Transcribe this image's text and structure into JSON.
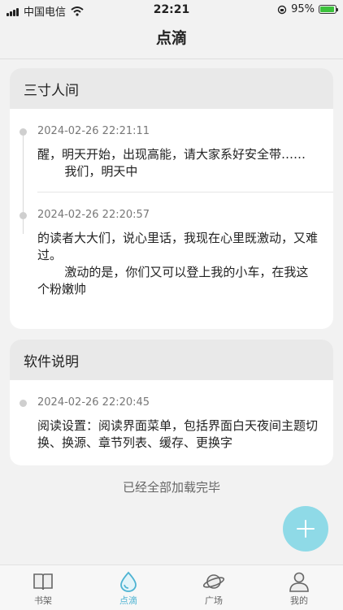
{
  "status": {
    "carrier": "中国电信",
    "time": "22:21",
    "battery": "95%",
    "battery_level": 0.95
  },
  "nav": {
    "title": "点滴"
  },
  "cards": [
    {
      "title": "三寸人间",
      "entries": [
        {
          "time": "2024-02-26 22:21:11",
          "text": "醒，明天开始，出现高能，请大家系好安全带……\n       我们，明天中"
        },
        {
          "time": "2024-02-26 22:20:57",
          "text": "的读者大大们，说心里话，我现在心里既激动，又难过。\n       激动的是，你们又可以登上我的小车，在我这个粉嫩帅"
        }
      ]
    },
    {
      "title": "软件说明",
      "entries": [
        {
          "time": "2024-02-26 22:20:45",
          "text": "阅读设置：阅读界面菜单，包括界面白天夜间主题切换、换源、章节列表、缓存、更换字"
        }
      ]
    }
  ],
  "footer": {
    "loaded_all": "已经全部加载完毕"
  },
  "tabs": [
    {
      "label": "书架",
      "icon": "book-icon"
    },
    {
      "label": "点滴",
      "icon": "droplet-icon",
      "active": true
    },
    {
      "label": "广场",
      "icon": "planet-icon"
    },
    {
      "label": "我的",
      "icon": "person-icon"
    }
  ],
  "colors": {
    "accent": "#4db3d2",
    "fab": "#8fdae7",
    "card_header": "#e9e9e9",
    "background": "#f2f2f2"
  }
}
